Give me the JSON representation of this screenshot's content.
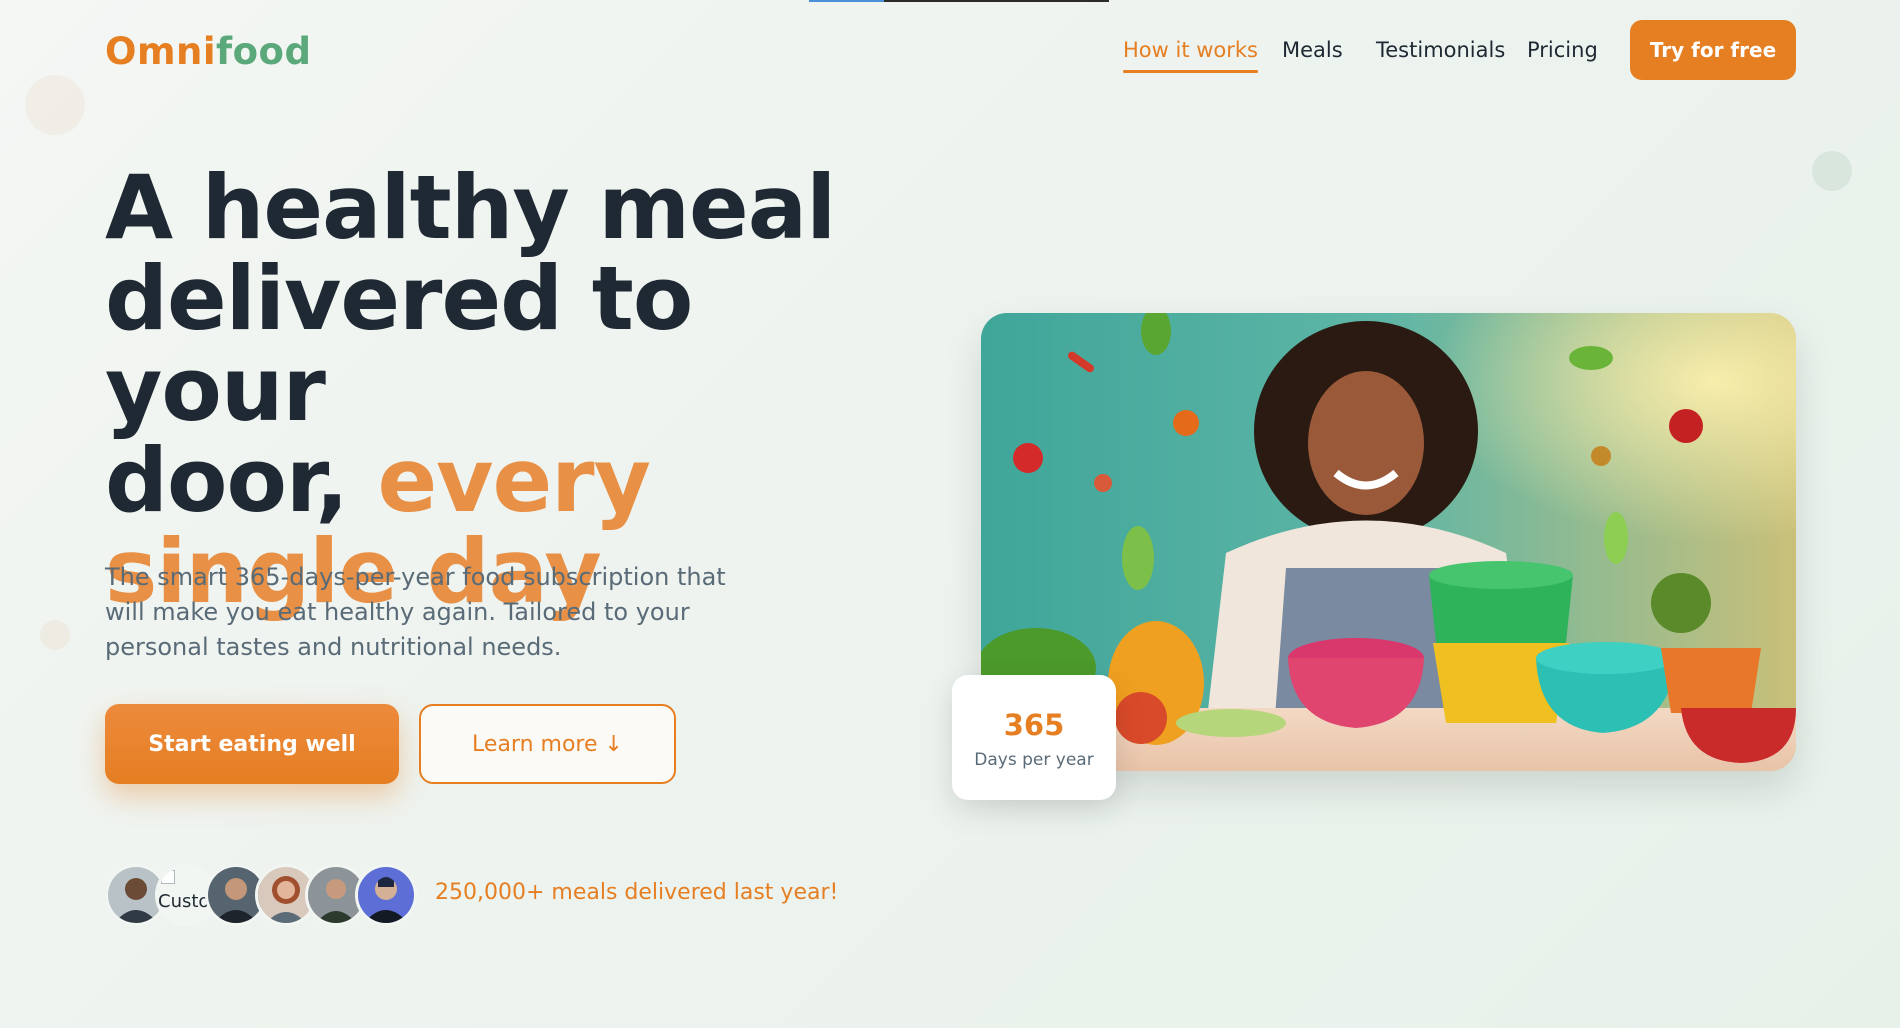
{
  "brand": {
    "part1": "Omni",
    "part2": "food",
    "accent": "#e67e22",
    "accent2": "#5ba87a"
  },
  "nav": {
    "items": [
      {
        "label": "How it works",
        "active": true
      },
      {
        "label": "Meals",
        "active": false
      },
      {
        "label": "Testimonials",
        "active": false
      },
      {
        "label": "Pricing",
        "active": false
      }
    ],
    "cta_label": "Try for free"
  },
  "scroll_progress": 0.25,
  "hero": {
    "headline_line1": "A healthy meal",
    "headline_line2": "delivered to your",
    "headline_line3_start": "door, ",
    "headline_accent": "every single day",
    "subtitle": "The smart 365-days-per-year food subscription that will make you eat healthy again. Tailored to your personal tastes and nutritional needs.",
    "primary_button": "Start eating well",
    "secondary_button": "Learn more ↓",
    "broken_avatar_alt": "Customer",
    "delivered_text": "250,000+ meals delivered last year!"
  },
  "image": {
    "icon": "woman-with-salad-bowls-photo"
  },
  "stat": {
    "number": "365",
    "label": "Days per year"
  }
}
